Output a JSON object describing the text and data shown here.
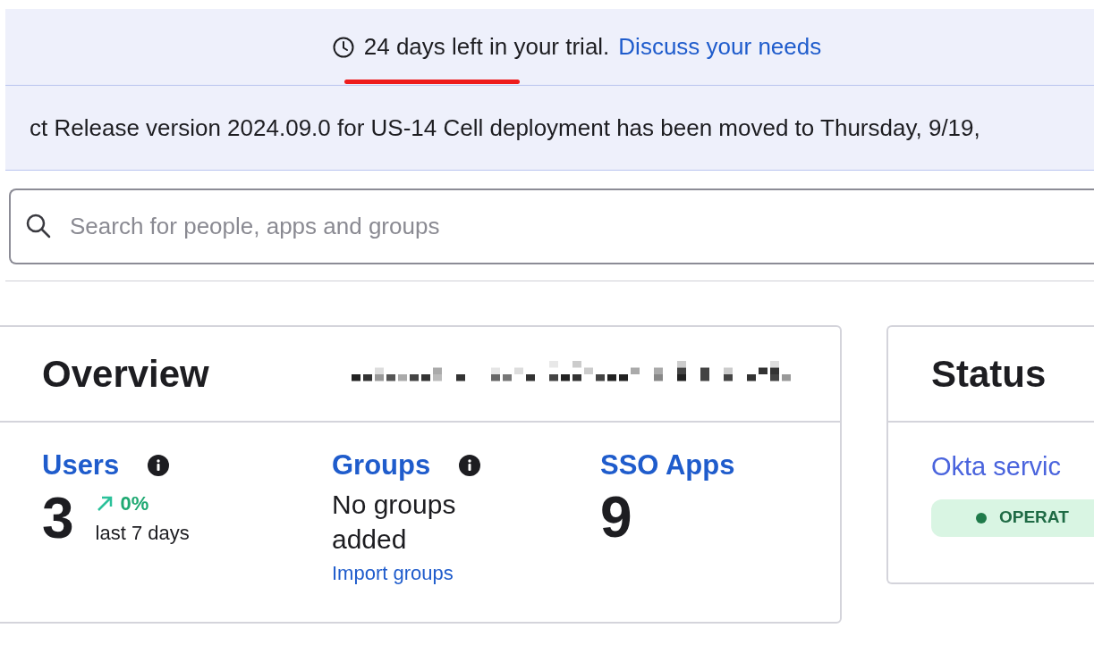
{
  "trial_banner": {
    "text": "24 days left in your trial.",
    "link": "Discuss your needs"
  },
  "announcement": {
    "text": "ct Release version 2024.09.0 for US-14 Cell deployment has been moved to Thursday, 9/19,"
  },
  "search": {
    "placeholder": "Search for people, apps and groups"
  },
  "overview": {
    "title": "Overview",
    "metrics": [
      {
        "kind": "count",
        "label": "Users",
        "info": true,
        "value": "3",
        "trend": "0%",
        "trend_caption": "last 7 days"
      },
      {
        "kind": "empty",
        "label": "Groups",
        "info": true,
        "message": "No groups added",
        "action": "Import groups"
      },
      {
        "kind": "count",
        "label": "SSO Apps",
        "info": false,
        "value": "9"
      }
    ]
  },
  "status": {
    "title": "Status",
    "service": "Okta servic",
    "badge": {
      "text": "OPERAT",
      "color": "#1f7a4a"
    }
  }
}
